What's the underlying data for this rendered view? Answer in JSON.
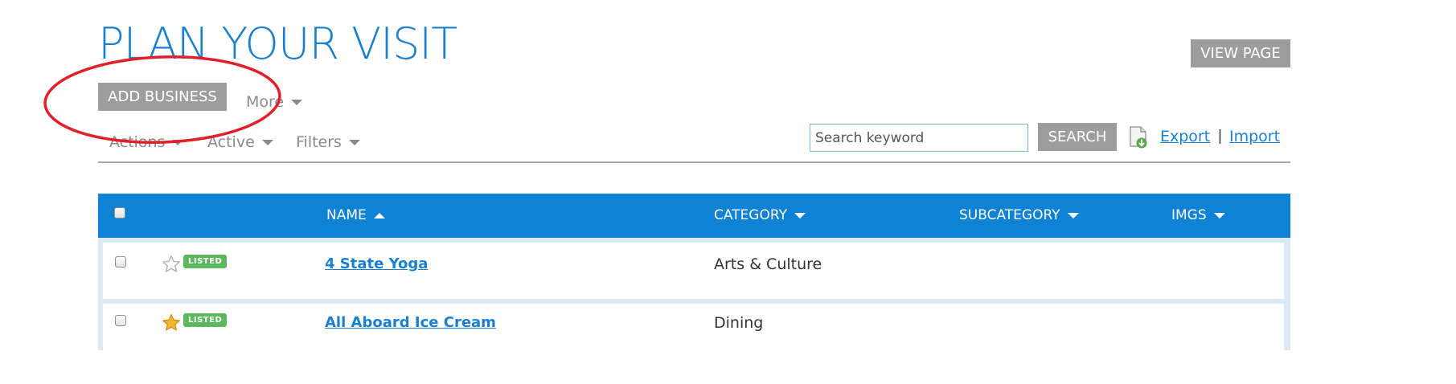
{
  "page": {
    "title": "PLAN YOUR VISIT"
  },
  "toolbar": {
    "view_page_label": "VIEW PAGE",
    "add_business_label": "ADD BUSINESS",
    "more_label": "More",
    "actions_label": "Actions",
    "active_label": "Active",
    "filters_label": "Filters",
    "search_placeholder": "Search keyword",
    "search_value": "",
    "search_button_label": "SEARCH",
    "export_label": "Export",
    "separator": "|",
    "import_label": "Import"
  },
  "table": {
    "columns": [
      {
        "label": "NAME",
        "sort": "asc"
      },
      {
        "label": "CATEGORY",
        "sort": "dropdown"
      },
      {
        "label": "SUBCATEGORY",
        "sort": "dropdown"
      },
      {
        "label": "IMGS",
        "sort": "dropdown"
      }
    ],
    "rows": [
      {
        "starred": false,
        "status": "LISTED",
        "name": "4 State Yoga",
        "category": "Arts & Culture",
        "subcategory": "",
        "imgs": ""
      },
      {
        "starred": true,
        "status": "LISTED",
        "name": "All Aboard Ice Cream",
        "category": "Dining",
        "subcategory": "",
        "imgs": ""
      }
    ]
  },
  "colors": {
    "accent": "#1a7fcf",
    "header_bg": "#0e82d5",
    "button_gray": "#9d9d9d",
    "badge_green": "#5cb85c",
    "annotation_red": "#e0202a",
    "star_gold": "#f2b630"
  },
  "icons": {
    "export": "export-file-icon",
    "star_empty": "star-outline-icon",
    "star_filled": "star-filled-icon"
  },
  "annotation": {
    "shape": "red-oval",
    "target": "add-business-button"
  }
}
